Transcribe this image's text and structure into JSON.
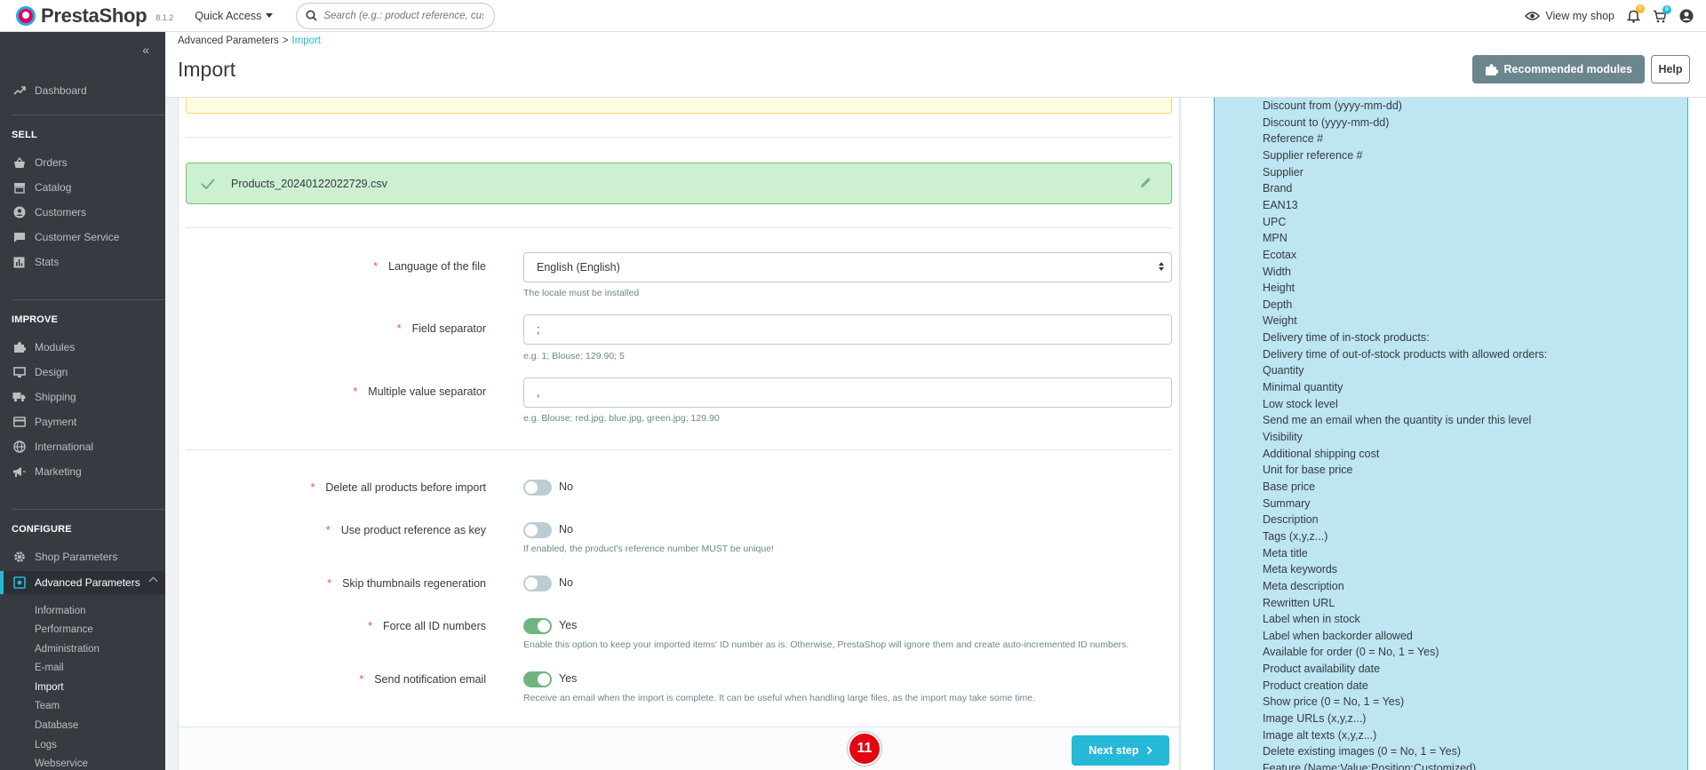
{
  "header": {
    "brand": "PrestaShop",
    "version": "8.1.2",
    "quick_access": "Quick Access",
    "search_placeholder": "Search (e.g.: product reference, custon",
    "view_shop": "View my shop",
    "notif_count": "6",
    "orders_count": "8"
  },
  "sidebar": {
    "dashboard": "Dashboard",
    "sections": {
      "sell": "SELL",
      "improve": "IMPROVE",
      "configure": "CONFIGURE"
    },
    "sell_items": [
      "Orders",
      "Catalog",
      "Customers",
      "Customer Service",
      "Stats"
    ],
    "improve_items": [
      "Modules",
      "Design",
      "Shipping",
      "Payment",
      "International",
      "Marketing"
    ],
    "configure_items": [
      "Shop Parameters",
      "Advanced Parameters"
    ],
    "sub_items": [
      "Information",
      "Performance",
      "Administration",
      "E-mail",
      "Import",
      "Team",
      "Database",
      "Logs",
      "Webservice"
    ]
  },
  "page": {
    "breadcrumb_parent": "Advanced Parameters",
    "breadcrumb_sep": ">",
    "breadcrumb_current": "Import",
    "title": "Import",
    "recommended_modules": "Recommended modules",
    "help": "Help"
  },
  "form": {
    "file_name": "Products_20240122022729.csv",
    "language_label": "Language of the file",
    "language_value": "English (English)",
    "language_help": "The locale must be installed",
    "field_sep_label": "Field separator",
    "field_sep_value": ";",
    "field_sep_help": "e.g. 1; Blouse; 129.90; 5",
    "multi_sep_label": "Multiple value separator",
    "multi_sep_value": ",",
    "multi_sep_help": "e.g. Blouse; red.jpg, blue.jpg, green.jpg; 129.90",
    "delete_label": "Delete all products before import",
    "delete_value": "No",
    "use_ref_label": "Use product reference as key",
    "use_ref_value": "No",
    "use_ref_help": "If enabled, the product's reference number MUST be unique!",
    "skip_thumb_label": "Skip thumbnails regeneration",
    "skip_thumb_value": "No",
    "force_ids_label": "Force all ID numbers",
    "force_ids_value": "Yes",
    "force_ids_help": "Enable this option to keep your imported items' ID number as is. Otherwise, PrestaShop will ignore them and create auto-incremented ID numbers.",
    "send_email_label": "Send notification email",
    "send_email_value": "Yes",
    "send_email_help": "Receive an email when the import is complete. It can be useful when handling large files, as the import may take some time.",
    "required_mark": "*",
    "step_number": "11",
    "next_step": "Next step"
  },
  "available_fields": [
    "Discount from (yyyy-mm-dd)",
    "Discount to (yyyy-mm-dd)",
    "Reference #",
    "Supplier reference #",
    "Supplier",
    "Brand",
    "EAN13",
    "UPC",
    "MPN",
    "Ecotax",
    "Width",
    "Height",
    "Depth",
    "Weight",
    "Delivery time of in-stock products:",
    "Delivery time of out-of-stock products with allowed orders:",
    "Quantity",
    "Minimal quantity",
    "Low stock level",
    "Send me an email when the quantity is under this level",
    "Visibility",
    "Additional shipping cost",
    "Unit for base price",
    "Base price",
    "Summary",
    "Description",
    "Tags (x,y,z...)",
    "Meta title",
    "Meta keywords",
    "Meta description",
    "Rewritten URL",
    "Label when in stock",
    "Label when backorder allowed",
    "Available for order (0 = No, 1 = Yes)",
    "Product availability date",
    "Product creation date",
    "Show price (0 = No, 1 = Yes)",
    "Image URLs (x,y,z...)",
    "Image alt texts (x,y,z...)",
    "Delete existing images (0 = No, 1 = Yes)",
    "Feature (Name:Value:Position:Customized)"
  ],
  "colors": {
    "accent": "#25b9d7",
    "sidebar_bg": "#363a41",
    "success_bg": "#cdf0d1",
    "switch_on": "#70b580",
    "badge_red": "#e30613"
  }
}
